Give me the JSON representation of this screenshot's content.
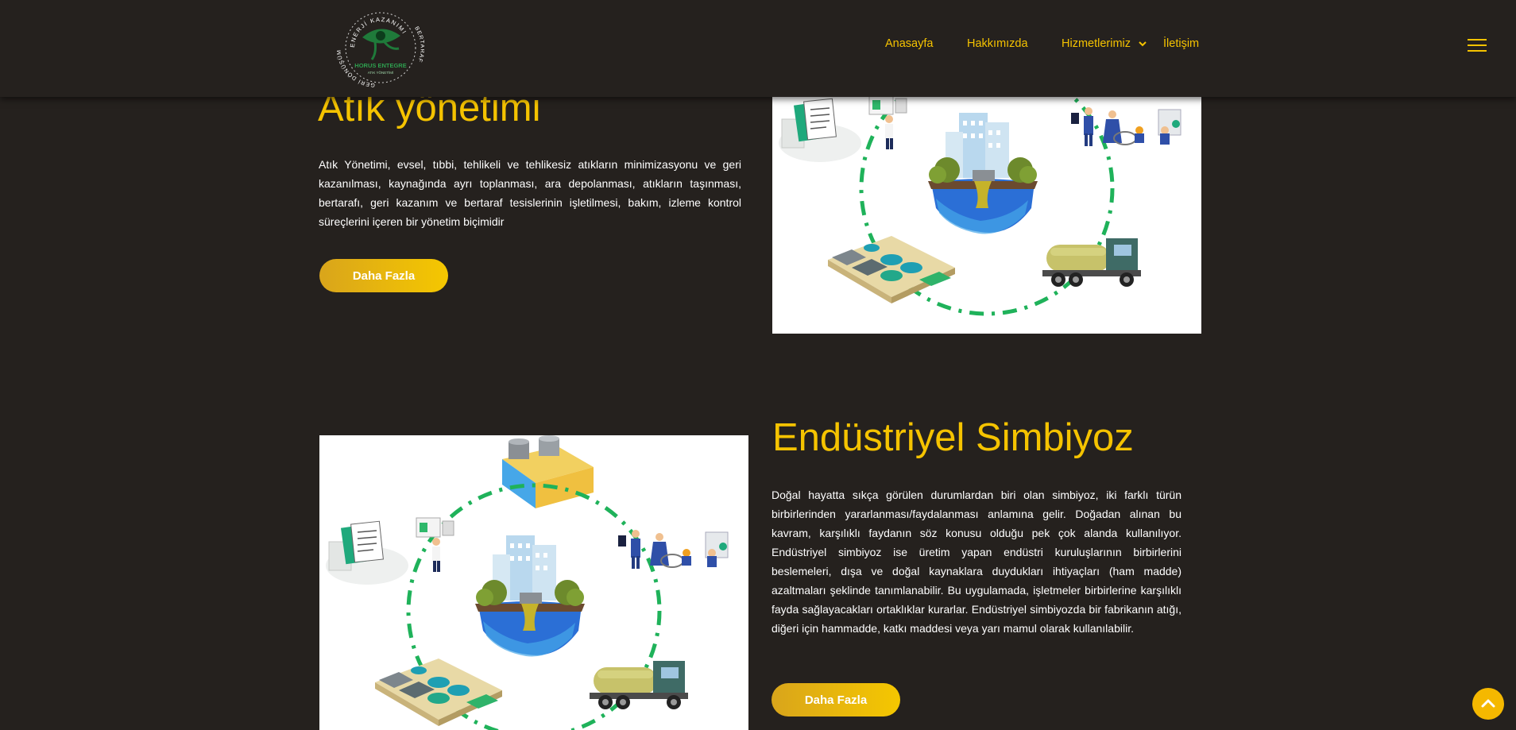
{
  "header": {
    "logo": {
      "text_top": "ENERJİ KAZANIMI",
      "text_left": "GERİ DÖNÜŞÜM",
      "text_right": "BERTARAF",
      "brand": "HORUS ENTEGRE",
      "tagline": "ATIK YÖNETİMİ"
    },
    "nav": [
      {
        "label": "Anasayfa"
      },
      {
        "label": "Hakkımızda"
      },
      {
        "label": "Hizmetlerimiz"
      },
      {
        "label": "İletişim"
      }
    ]
  },
  "sections": [
    {
      "title": "Atık yönetimi",
      "text": "Atık Yönetimi, evsel, tıbbi, tehlikeli ve tehlikesiz atıkların minimizasyonu ve geri kazanılması, kaynağında ayrı toplanması, ara depolanması, atıkların taşınması, bertarafı, geri kazanım ve bertaraf tesislerinin işletilmesi, bakım, izleme kontrol süreçlerini içeren bir yönetim biçimidir",
      "button": "Daha Fazla"
    },
    {
      "title": "Endüstriyel Simbiyoz",
      "text": "Doğal hayatta sıkça görülen durumlardan biri olan simbiyoz, iki farklı türün birbirlerinden yararlanması/faydalanması anlamına gelir. Doğadan alınan bu kavram, karşılıklı faydanın söz konusu olduğu pek çok alanda kullanılıyor. Endüstriyel simbiyoz ise üretim yapan endüstri kuruluşlarının birbirlerini beslemeleri, dışa ve doğal kaynaklara duydukları ihtiyaçları (ham madde) azaltmaları şeklinde tanımlanabilir. Bu uygulamada, işletmeler birbirlerine karşılıklı fayda sağlayacakları ortaklıklar kurarlar. Endüstriyel simbiyozda bir fabrikanın atığı, diğeri için hammadde, katkı maddesi veya yarı mamul olarak kullanılabilir.",
      "button": "Daha Fazla"
    }
  ],
  "icons": {
    "menu": "hamburger-menu-icon",
    "chevron": "chevron-down-icon",
    "scroll": "arrow-up-icon"
  },
  "colors": {
    "background": "#25211e",
    "accent": "#f5c300",
    "button_start": "#d9a51b",
    "button_end": "#f5c700",
    "cycle_green": "#1fb25a"
  }
}
